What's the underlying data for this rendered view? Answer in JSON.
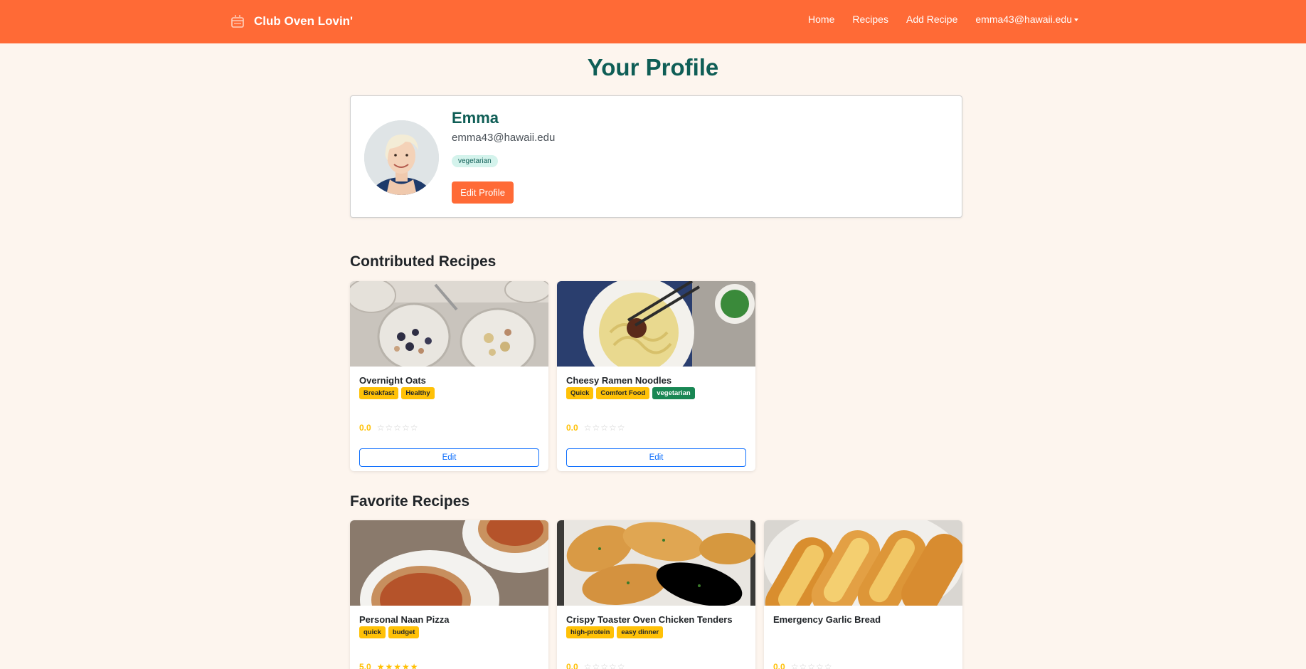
{
  "navbar": {
    "brand": "Club Oven Lovin'",
    "brand_icon": "oven-icon",
    "links": [
      "Home",
      "Recipes",
      "Add Recipe"
    ],
    "user_menu": "emma43@hawaii.edu",
    "color": "#ff6a36"
  },
  "page": {
    "title": "Your Profile"
  },
  "profile": {
    "name": "Emma",
    "email": "emma43@hawaii.edu",
    "dietary_badge": "vegetarian",
    "edit_button": "Edit Profile"
  },
  "contributed": {
    "title": "Contributed Recipes",
    "recipes": [
      {
        "title": "Overnight Oats",
        "tags": [
          "Breakfast",
          "Healthy"
        ],
        "rating": "0.0",
        "stars_filled": 0,
        "edit_label": "Edit"
      },
      {
        "title": "Cheesy Ramen Noodles",
        "tags": [
          "Quick",
          "Comfort Food"
        ],
        "diet_tag": "vegetarian",
        "rating": "0.0",
        "stars_filled": 0,
        "edit_label": "Edit"
      }
    ]
  },
  "favorites": {
    "title": "Favorite Recipes",
    "recipes": [
      {
        "title": "Personal Naan Pizza",
        "tags": [
          "quick",
          "budget"
        ],
        "rating": "5.0",
        "stars_filled": 5
      },
      {
        "title": "Crispy Toaster Oven Chicken Tenders",
        "tags": [
          "high-protein",
          "easy dinner"
        ],
        "rating": "0.0",
        "stars_filled": 0
      },
      {
        "title": "Emergency Garlic Bread",
        "tags": [],
        "rating": "0.0",
        "stars_filled": 0
      }
    ]
  }
}
